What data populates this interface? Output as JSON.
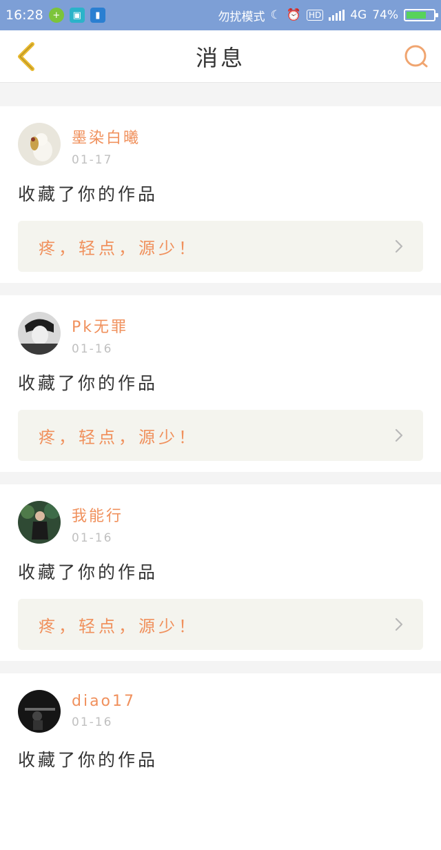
{
  "status_bar": {
    "time": "16:28",
    "mode": "勿扰模式",
    "network": "4G",
    "battery": "74%",
    "battery_level": 0.74
  },
  "nav": {
    "title": "消息"
  },
  "messages": [
    {
      "username": "墨染白曦",
      "date": "01-17",
      "action": "收藏了你的作品",
      "work_title": "疼，轻点，源少！"
    },
    {
      "username": "Pk无罪",
      "date": "01-16",
      "action": "收藏了你的作品",
      "work_title": "疼，轻点，源少！"
    },
    {
      "username": "我能行",
      "date": "01-16",
      "action": "收藏了你的作品",
      "work_title": "疼，轻点，源少！"
    },
    {
      "username": "diao17",
      "date": "01-16",
      "action": "收藏了你的作品"
    }
  ],
  "colors": {
    "accent": "#f0905c",
    "status_bar": "#7d9fd6",
    "back_icon": "#e8b92e",
    "search_icon": "#f0a570"
  }
}
